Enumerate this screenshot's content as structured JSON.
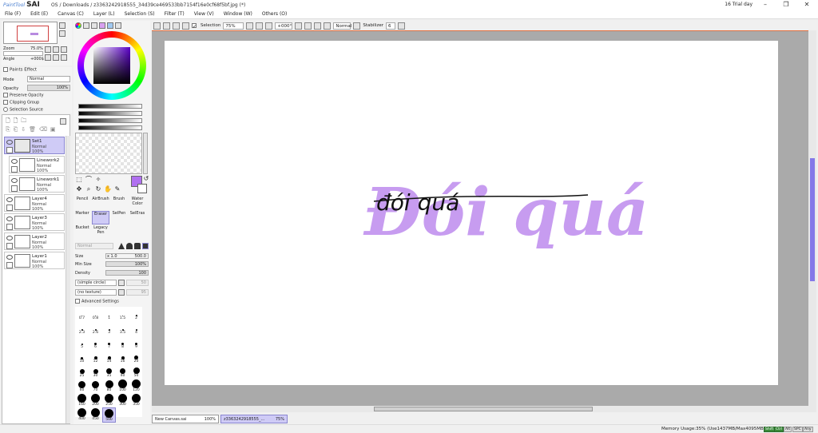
{
  "titlebar": {
    "app_brand": "PaintTool",
    "app_name": "SAI",
    "title": "OS / Downloads / z3363242918555_34d39ce469533bb7154f16e0cf68f5bf.jpg (*)",
    "trial": "16 Trial day"
  },
  "menu": [
    "File (F)",
    "Edit (E)",
    "Canvas (C)",
    "Layer (L)",
    "Selection (S)",
    "Filter (T)",
    "View (V)",
    "Window (W)",
    "Others (O)"
  ],
  "navigator": {
    "zoom_label": "Zoom",
    "zoom_value": "75.0%",
    "angle_label": "Angle",
    "angle_value": "+000$"
  },
  "layer_props": {
    "paints_effect": "Paints Effect",
    "mode_label": "Mode",
    "mode_value": "Normal",
    "opacity_label": "Opacity",
    "opacity_value": "100%",
    "preserve_opacity": "Preserve Opacity",
    "clipping_group": "Clipping Group",
    "selection_source": "Selection Source"
  },
  "layers": [
    {
      "name": "Set1",
      "mode": "Normal",
      "opacity": "100%",
      "selected": true,
      "folder": true
    },
    {
      "name": "Linework2",
      "mode": "Normal",
      "opacity": "100%"
    },
    {
      "name": "Linework1",
      "mode": "Normal",
      "opacity": "100%"
    },
    {
      "name": "Layer4",
      "mode": "Normal",
      "opacity": "100%"
    },
    {
      "name": "Layer3",
      "mode": "Normal",
      "opacity": "100%"
    },
    {
      "name": "Layer2",
      "mode": "Normal",
      "opacity": "100%"
    },
    {
      "name": "Layer1",
      "mode": "Normal",
      "opacity": "100%"
    }
  ],
  "colors": {
    "primary": "#b070f0",
    "accent": "#8478e8",
    "lettering": "#c79cf0"
  },
  "brushes": [
    {
      "label": "Pencil"
    },
    {
      "label": "AirBrush"
    },
    {
      "label": "Brush"
    },
    {
      "label": "Water Color"
    },
    {
      "label": "Marker"
    },
    {
      "label": "Eraser",
      "selected": true
    },
    {
      "label": "SelPen"
    },
    {
      "label": "SelEras"
    },
    {
      "label": "Bucket"
    },
    {
      "label": "Legacy Pen"
    }
  ],
  "brush_props": {
    "blend_mode": "Normal",
    "size_label": "Size",
    "size_mult": "x 1.0",
    "size_value": "500.0",
    "minsize_label": "Min Size",
    "minsize_value": "100%",
    "density_label": "Density",
    "density_value": "100",
    "shape": "(simple circle)",
    "shape_value": "50",
    "texture": "(no texture)",
    "texture_value": "95",
    "advanced": "Advanced Settings"
  },
  "brush_sizes": [
    "0.7",
    "0.8",
    "1",
    "1.5",
    "2",
    "2.3",
    "2.6",
    "3",
    "3.5",
    "4",
    "5",
    "6",
    "7",
    "8",
    "9",
    "10",
    "12",
    "14",
    "16",
    "20",
    "25",
    "30",
    "35",
    "40",
    "50",
    "60",
    "70",
    "80",
    "100",
    "120",
    "160",
    "200",
    "250",
    "300",
    "350",
    "400",
    "450",
    "500"
  ],
  "toolbar": {
    "selection_label": "Selection",
    "zoom": "75%",
    "angle": "+000°",
    "blend": "Normal",
    "stabilizer_label": "Stabilizer",
    "stabilizer_value": "6"
  },
  "canvas_text": {
    "big": "Đói quá",
    "script": "đói quá"
  },
  "tabs": [
    {
      "name": "New Canvas.sai",
      "zoom": "100%"
    },
    {
      "name": "z3363242918555_...",
      "zoom": "75%",
      "active": true
    }
  ],
  "status": {
    "memory": "Memory Usage:35% (Use1437MB/Max4095MB)",
    "indicators": [
      "Shift",
      "Ctrl",
      "Alt",
      "SPC",
      "Any"
    ]
  }
}
